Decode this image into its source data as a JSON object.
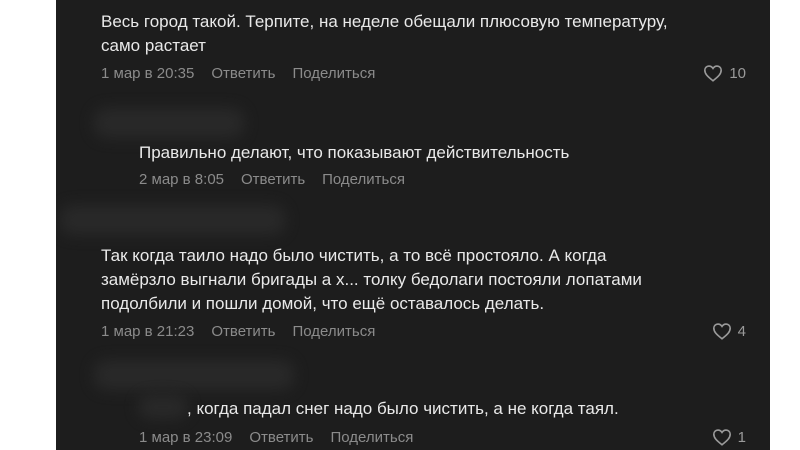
{
  "comments": [
    {
      "text": "Весь город такой. Терпите, на неделе обещали плюсовую температуру,\nсамо растает",
      "date": "1 мар в 20:35",
      "reply": "Ответить",
      "share": "Поделиться",
      "likes": "10"
    },
    {
      "text": "Правильно делают, что показывают действительность",
      "date": "2 мар в 8:05",
      "reply": "Ответить",
      "share": "Поделиться"
    },
    {
      "text": "Так когда таило надо было чистить, а то всё простояло. А когда\nзамёрзло выгнали бригады а х... толку бедолаги постояли лопатами\nподолбили и пошли домой, что ещё оставалось делать.",
      "date": "1 мар в 21:23",
      "reply": "Ответить",
      "share": "Поделиться",
      "likes": "4"
    },
    {
      "text": ", когда падал снег надо было чистить, а не когда таял.",
      "date": "1 мар в 23:09",
      "reply": "Ответить",
      "share": "Поделиться",
      "likes": "1"
    }
  ],
  "icons": {
    "like": "heart-icon"
  },
  "colors": {
    "background": "#1d1d1d",
    "text": "#e9e9e9",
    "meta": "#8b8b8b"
  }
}
